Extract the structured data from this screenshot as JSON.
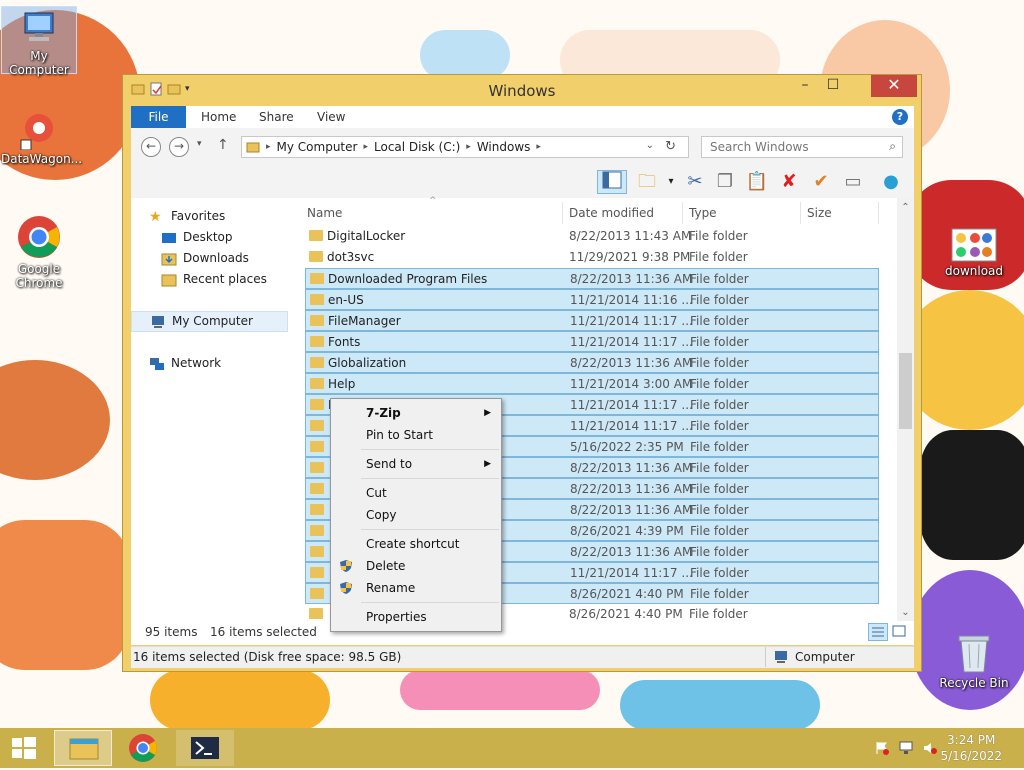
{
  "desktop": {
    "icons": [
      {
        "label": "My Computer"
      },
      {
        "label": "DataWagon..."
      },
      {
        "label": "Google Chrome"
      },
      {
        "label": "download"
      },
      {
        "label": "Recycle Bin"
      }
    ]
  },
  "window": {
    "title": "Windows",
    "ribbon_tabs": [
      "File",
      "Home",
      "Share",
      "View"
    ],
    "help_label": "?",
    "address": {
      "crumbs": [
        "My Computer",
        "Local Disk (C:)",
        "Windows"
      ]
    },
    "search_placeholder": "Search Windows",
    "nav": {
      "favorites": "Favorites",
      "desktop": "Desktop",
      "downloads": "Downloads",
      "recent": "Recent places",
      "computer": "My Computer",
      "network": "Network"
    },
    "columns": {
      "name": "Name",
      "date": "Date modified",
      "type": "Type",
      "size": "Size"
    },
    "rows": [
      {
        "name": "DigitalLocker",
        "date": "8/22/2013 11:43 AM",
        "type": "File folder"
      },
      {
        "name": "dot3svc",
        "date": "11/29/2021 9:38 PM",
        "type": "File folder"
      },
      {
        "name": "Downloaded Program Files",
        "date": "8/22/2013 11:36 AM",
        "type": "File folder"
      },
      {
        "name": "en-US",
        "date": "11/21/2014 11:16 ...",
        "type": "File folder"
      },
      {
        "name": "FileManager",
        "date": "11/21/2014 11:17 ...",
        "type": "File folder"
      },
      {
        "name": "Fonts",
        "date": "11/21/2014 11:17 ...",
        "type": "File folder"
      },
      {
        "name": "Globalization",
        "date": "8/22/2013 11:36 AM",
        "type": "File folder"
      },
      {
        "name": "Help",
        "date": "11/21/2014 3:00 AM",
        "type": "File folder"
      },
      {
        "name": "IME",
        "date": "11/21/2014 11:17 ...",
        "type": "File folder"
      },
      {
        "name": "",
        "date": "11/21/2014 11:17 ...",
        "type": "File folder"
      },
      {
        "name": "",
        "date": "5/16/2022 2:35 PM",
        "type": "File folder"
      },
      {
        "name": "",
        "date": "8/22/2013 11:36 AM",
        "type": "File folder"
      },
      {
        "name": "",
        "date": "8/22/2013 11:36 AM",
        "type": "File folder"
      },
      {
        "name": "",
        "date": "8/22/2013 11:36 AM",
        "type": "File folder"
      },
      {
        "name": "",
        "date": "8/26/2021 4:39 PM",
        "type": "File folder"
      },
      {
        "name": "",
        "date": "8/22/2013 11:36 AM",
        "type": "File folder"
      },
      {
        "name": "",
        "date": "11/21/2014 11:17 ...",
        "type": "File folder"
      },
      {
        "name": "",
        "date": "8/26/2021 4:40 PM",
        "type": "File folder"
      },
      {
        "name": "",
        "date": "8/26/2021 4:40 PM",
        "type": "File folder"
      }
    ],
    "status": {
      "item_count": "95 items",
      "selected": "16 items selected",
      "bottom_left": "16 items selected (Disk free space: 98.5 GB)",
      "bottom_right": "Computer"
    }
  },
  "context_menu": {
    "zip": "7-Zip",
    "pin": "Pin to Start",
    "send_to": "Send to",
    "cut": "Cut",
    "copy": "Copy",
    "create_shortcut": "Create shortcut",
    "delete": "Delete",
    "rename": "Rename",
    "properties": "Properties"
  },
  "taskbar": {
    "time": "3:24 PM",
    "date": "5/16/2022"
  },
  "colors": {
    "window_frame": "#f1cf6b",
    "selection": "#cde8f7",
    "accent": "#1f6fc5",
    "taskbar": "#c9b04a"
  }
}
